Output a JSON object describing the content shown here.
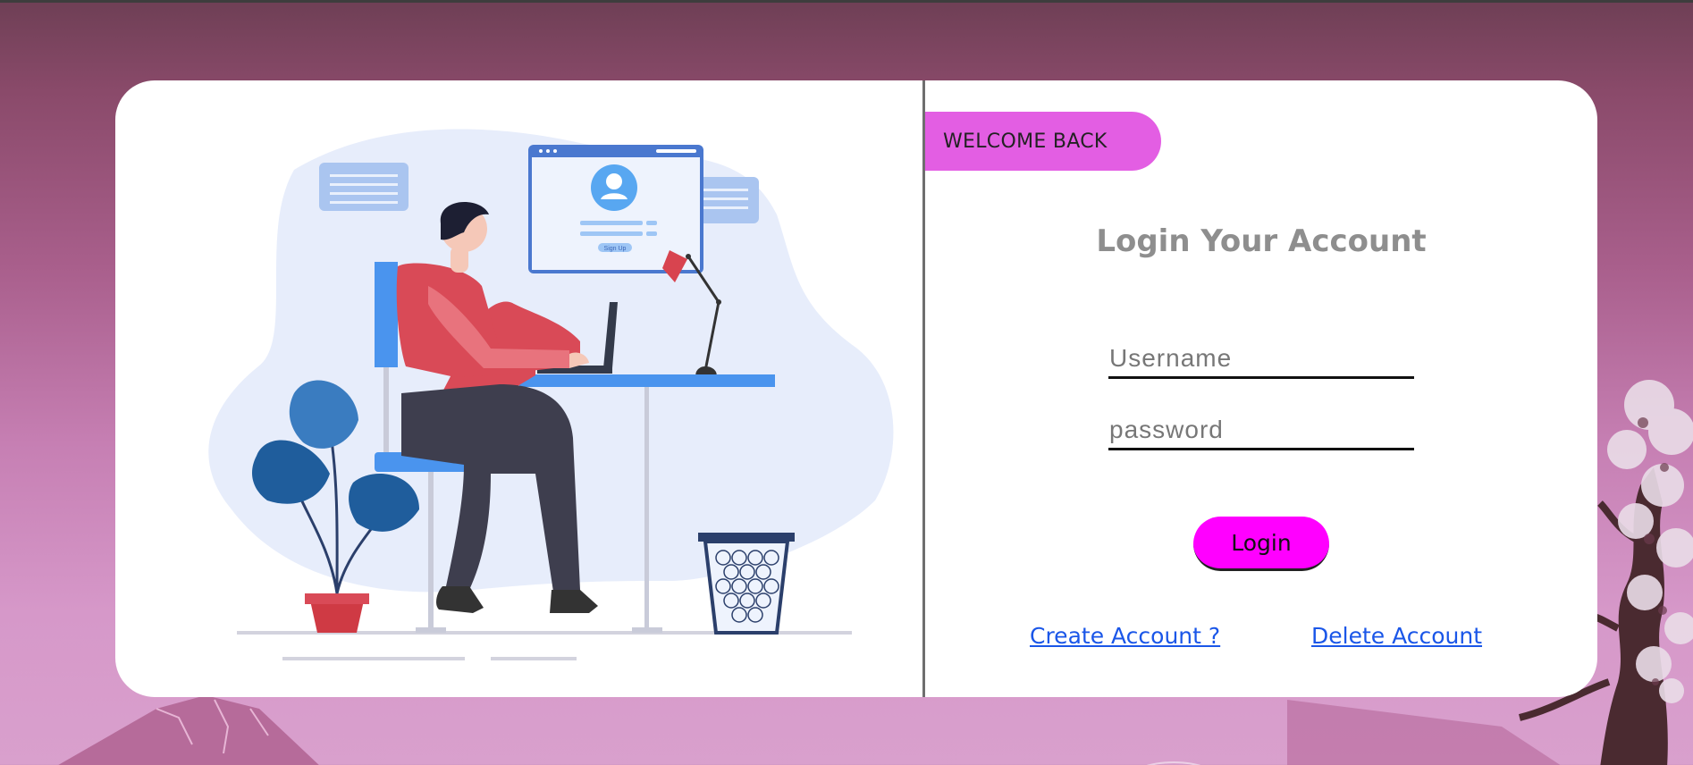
{
  "welcome_label": "WELCOME BACK",
  "title": "Login Your Account",
  "form": {
    "username_placeholder": "Username",
    "username_value": "",
    "password_placeholder": "password",
    "password_value": ""
  },
  "login_button": "Login",
  "links": {
    "create": "Create Account ?",
    "delete": "Delete Account"
  },
  "illustration": {
    "screen_button": "Sign Up",
    "icons": [
      "user-avatar-icon",
      "desk-lamp-icon",
      "laptop-icon",
      "plant-icon",
      "wastebasket-icon"
    ]
  },
  "colors": {
    "accent": "#e35ee3",
    "button": "#ff00ff",
    "link": "#1a56e8",
    "title": "#8e8e8e"
  }
}
